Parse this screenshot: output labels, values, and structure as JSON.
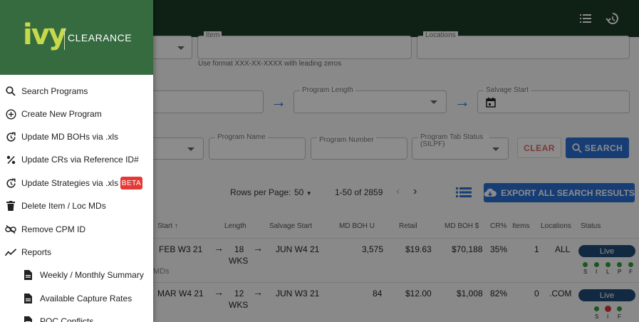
{
  "brand": {
    "logo": "ivy",
    "name": "CLEARANCE",
    "colors": {
      "header": "#356b3f",
      "accent": "#c5d94a",
      "primary": "#2a6fd6"
    }
  },
  "topbar": {
    "icons": [
      "list-icon",
      "history-icon"
    ]
  },
  "filters": {
    "item_label": "Item",
    "item_hint": "Use format XXX-XX-XXXX with leading zeros",
    "locations_label": "Locations",
    "program_length_label": "Program Length",
    "salvage_start_label": "Salvage Start",
    "program_name_label": "Program Name",
    "program_number_label": "Program Number",
    "program_tab_status_label": "Program Tab Status (SILPF)",
    "clear_label": "CLEAR",
    "search_label": "SEARCH"
  },
  "pagination": {
    "rows_per_page_label": "Rows per Page:",
    "rows_per_page": "50",
    "range": "1-50 of 2859"
  },
  "export_label": "EXPORT ALL SEARCH RESULTS",
  "table": {
    "headers": [
      "Start",
      "Length",
      "Salvage Start",
      "MD BOH U",
      "Retail",
      "MD BOH $",
      "CR%",
      "Items",
      "Locations",
      "Status"
    ],
    "note": "MDs",
    "rows": [
      {
        "start": "FEB W3 21",
        "length_num": "18",
        "length_unit": "WKS",
        "salvage": "JUN W4 21",
        "md_boh_u": "3,575",
        "retail": "$19.63",
        "md_boh_d": "$70,188",
        "cr": "35%",
        "items": "1",
        "locations": "ALL",
        "status": "Live",
        "flags": [
          "S",
          "I",
          "L",
          "P",
          "F"
        ]
      },
      {
        "start": "MAR W4 21",
        "length_num": "12",
        "length_unit": "WKS",
        "salvage": "JUN W3 21",
        "md_boh_u": "84",
        "retail": "$12.00",
        "md_boh_d": "$1,008",
        "cr": "82%",
        "items": "0",
        "locations": ".COM",
        "status": "Live",
        "flags": [
          "S",
          "I",
          "F"
        ]
      }
    ]
  },
  "drawer": {
    "items": [
      {
        "label": "Search Programs",
        "icon": "search-icon"
      },
      {
        "label": "Create New Program",
        "icon": "add-circle-icon"
      },
      {
        "label": "Update MD BOHs via .xls",
        "icon": "update-icon"
      },
      {
        "label": "Update CRs via Reference ID#",
        "icon": "percent-icon"
      },
      {
        "label": "Update Strategies via .xls",
        "icon": "update-icon",
        "badge": "BETA"
      },
      {
        "label": "Delete Item / Loc MDs",
        "icon": "trash-icon"
      },
      {
        "label": "Remove CPM ID",
        "icon": "link-off-icon"
      },
      {
        "label": "Reports",
        "icon": "trending-icon"
      },
      {
        "label": "Weekly / Monthly Summary",
        "icon": "document-icon"
      },
      {
        "label": "Available Capture Rates",
        "icon": "document-icon"
      },
      {
        "label": "POC Conflicts",
        "icon": "document-icon"
      }
    ]
  }
}
